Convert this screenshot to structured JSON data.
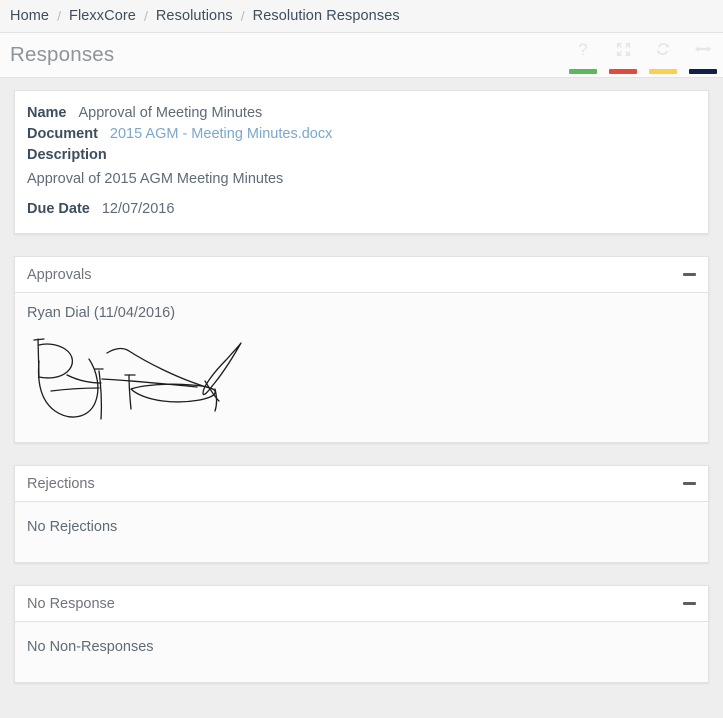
{
  "breadcrumb": {
    "separator": "/",
    "items": [
      {
        "label": "Home"
      },
      {
        "label": "FlexxCore"
      },
      {
        "label": "Resolutions"
      },
      {
        "label": "Resolution Responses"
      }
    ]
  },
  "header": {
    "title": "Responses",
    "tools": [
      {
        "name": "help-icon",
        "glyph": "?",
        "bar_color": "#5cb85c"
      },
      {
        "name": "expand-icon",
        "glyph": "expand",
        "bar_color": "#e24a3b"
      },
      {
        "name": "refresh-icon",
        "glyph": "refresh",
        "bar_color": "#fbd04e"
      },
      {
        "name": "resize-width-icon",
        "glyph": "resize",
        "bar_color": "#0e2149"
      }
    ]
  },
  "detail": {
    "name_label": "Name",
    "name_value": "Approval of Meeting Minutes",
    "document_label": "Document",
    "document_value": "2015 AGM - Meeting Minutes.docx",
    "description_label": "Description",
    "description_value": "Approval of 2015 AGM Meeting Minutes",
    "due_date_label": "Due Date",
    "due_date_value": "12/07/2016"
  },
  "panels": {
    "approvals": {
      "title": "Approvals",
      "approver": "Ryan Dial (11/04/2016)",
      "signature_alt": "handwritten-signature"
    },
    "rejections": {
      "title": "Rejections",
      "body_text": "No Rejections"
    },
    "no_response": {
      "title": "No Response",
      "body_text": "No Non-Responses"
    }
  },
  "colors": {
    "page_background": "#eeeeee",
    "link": "#7ba7cd",
    "label": "#3d4e5e",
    "text": "#5f6b77"
  }
}
